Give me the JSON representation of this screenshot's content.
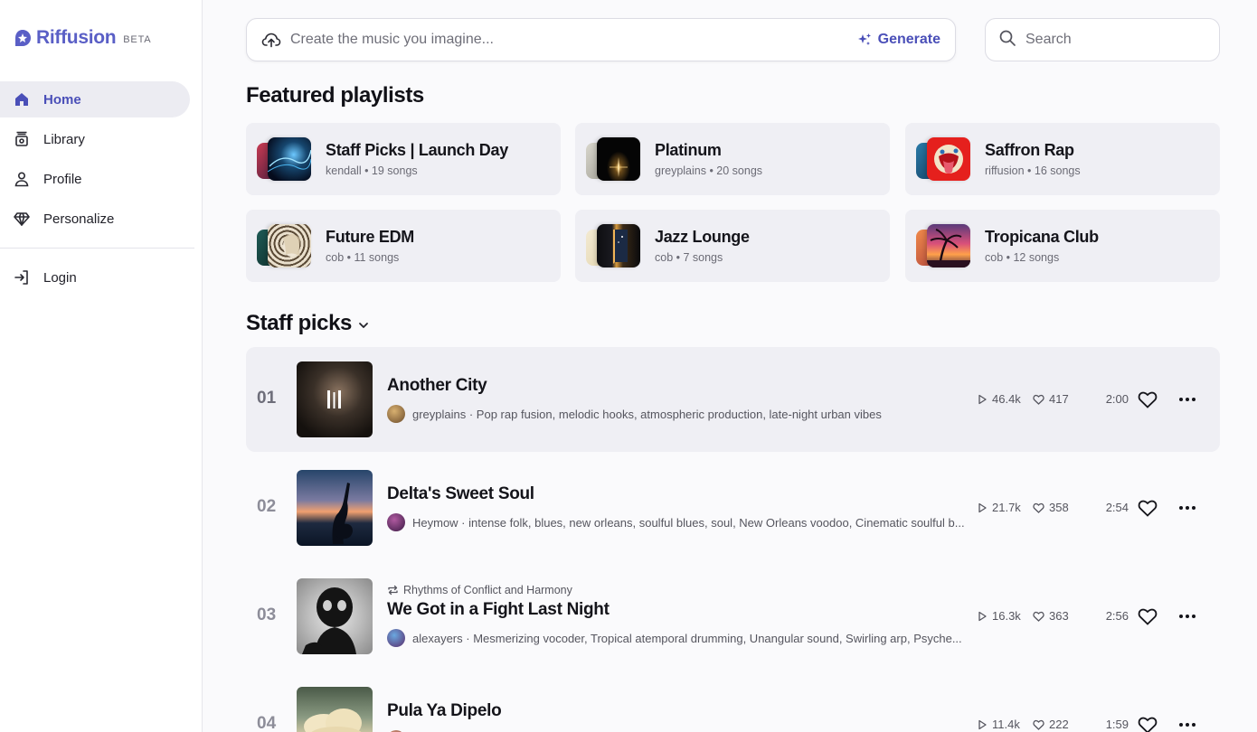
{
  "brand": {
    "name": "Riffusion",
    "badge": "BETA",
    "color": "#5a5fc6"
  },
  "sidebar": {
    "items": [
      {
        "label": "Home",
        "icon": "home-icon",
        "active": true
      },
      {
        "label": "Library",
        "icon": "library-icon",
        "active": false
      },
      {
        "label": "Profile",
        "icon": "profile-icon",
        "active": false
      },
      {
        "label": "Personalize",
        "icon": "gem-icon",
        "active": false
      }
    ],
    "login": {
      "label": "Login",
      "icon": "login-icon"
    }
  },
  "prompt": {
    "placeholder": "Create the music you imagine...",
    "generate_label": "Generate"
  },
  "search": {
    "placeholder": "Search"
  },
  "featured": {
    "title": "Featured playlists",
    "playlists": [
      {
        "title": "Staff Picks | Launch Day",
        "subtitle": "kendall • 19 songs"
      },
      {
        "title": "Platinum",
        "subtitle": "greyplains • 20 songs"
      },
      {
        "title": "Saffron Rap",
        "subtitle": "riffusion • 16 songs"
      },
      {
        "title": "Future EDM",
        "subtitle": "cob • 11 songs"
      },
      {
        "title": "Jazz Lounge",
        "subtitle": "cob • 7 songs"
      },
      {
        "title": "Tropicana Club",
        "subtitle": "cob • 12 songs"
      }
    ]
  },
  "staff": {
    "title": "Staff picks",
    "tracks": [
      {
        "num": "01",
        "title": "Another City",
        "context": "",
        "artist": "greyplains",
        "desc": "greyplains · Pop rap fusion, melodic hooks, atmospheric production, late-night urban vibes",
        "plays": "46.4k",
        "likes": "417",
        "duration": "2:00",
        "playing": true
      },
      {
        "num": "02",
        "title": "Delta's Sweet Soul",
        "context": "",
        "artist": "Heymow",
        "desc": "Heymow · intense folk, blues, new orleans, soulful blues, soul, New Orleans voodoo, Cinematic soulful b...",
        "plays": "21.7k",
        "likes": "358",
        "duration": "2:54",
        "playing": false
      },
      {
        "num": "03",
        "title": "We Got in a Fight Last Night",
        "context": "Rhythms of Conflict and Harmony",
        "artist": "alexayers",
        "desc": "alexayers · Mesmerizing vocoder, Tropical atemporal drumming, Unangular sound, Swirling arp, Psyche...",
        "plays": "16.3k",
        "likes": "363",
        "duration": "2:56",
        "playing": false
      },
      {
        "num": "04",
        "title": "Pula Ya Dipelo",
        "context": "",
        "artist": "",
        "desc": "",
        "plays": "11.4k",
        "likes": "222",
        "duration": "1:59",
        "playing": false
      }
    ]
  }
}
